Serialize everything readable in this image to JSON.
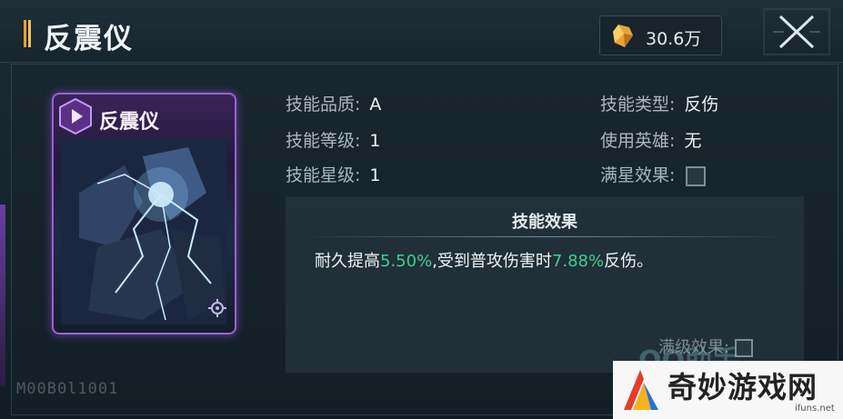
{
  "header": {
    "title": "反震仪",
    "currency_value": "30.6万"
  },
  "card": {
    "name": "反震仪",
    "rarity_color": "#9a62d4"
  },
  "stats": {
    "quality_label": "技能品质:",
    "quality_value": "A",
    "level_label": "技能等级:",
    "level_value": "1",
    "star_label": "技能星级:",
    "star_value": "1",
    "type_label": "技能类型:",
    "type_value": "反伤",
    "hero_label": "使用英雄:",
    "hero_value": "无",
    "full_star_label": "满星效果:"
  },
  "effect": {
    "title": "技能效果",
    "text_1": "耐久提高",
    "value_1": "5.50%",
    "text_2": ",受到普攻伤害时",
    "value_2": "7.88%",
    "text_3": "反伤。",
    "max_level_label": "满级效果:",
    "highlight_color": "#3fcf8f"
  },
  "serial": "M00B0l1001",
  "watermark": {
    "text": "奇妙游戏网",
    "url": "ifuns.net",
    "ghost": "QQ助手"
  },
  "icons": [
    "crystal-icon",
    "close-icon",
    "skill-hex-icon",
    "gear-icon",
    "checkbox-icon",
    "watermark-logo-icon"
  ]
}
